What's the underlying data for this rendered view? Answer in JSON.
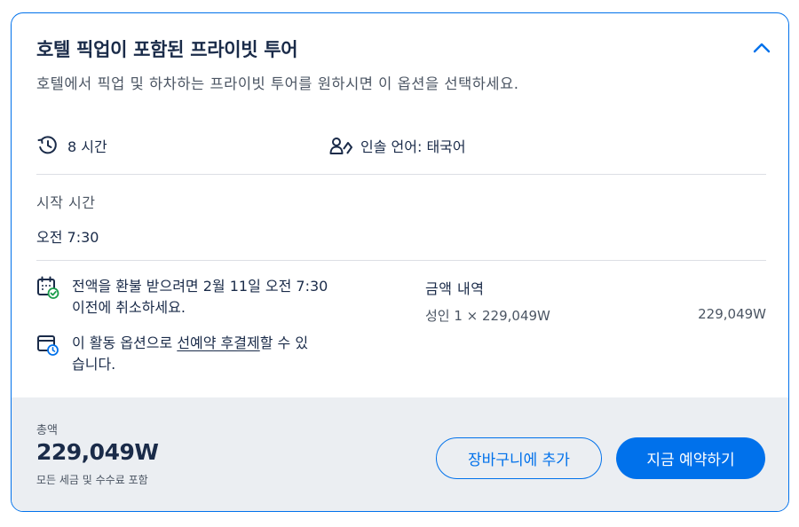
{
  "option": {
    "title": "호텔 픽업이 포함된 프라이빗 투어",
    "description": "호텔에서 픽업 및 하차하는 프라이빗 투어를 원하시면 이 옵션을 선택하세요.",
    "features": {
      "duration": {
        "icon": "clock-icon",
        "text": "8 시간"
      },
      "language": {
        "icon": "guide-language-icon",
        "text": "인솔 언어: 태국어"
      }
    },
    "start": {
      "label": "시작 시간",
      "time": "오전 7:30"
    },
    "cancellation": {
      "icon": "calendar-check-icon",
      "line1": "전액을 환불 받으려면 2월 11일 오전 7:30",
      "line2": "이전에 취소하세요."
    },
    "reserve": {
      "icon": "calendar-clock-icon",
      "before": "이 활동 옵션으로 ",
      "link": "선예약 후결제",
      "after": "할 수 있",
      "line2": "습니다."
    },
    "price": {
      "heading": "금액 내역",
      "row_label": "성인 1 × 229,049W",
      "row_value": "229,049W"
    }
  },
  "footer": {
    "total_label": "총액",
    "total_value": "229,049W",
    "total_note": "모든 세금 및 수수료 포함",
    "cart_button": "장바구니에 추가",
    "book_button": "지금 예약하기"
  },
  "colors": {
    "accent": "#0071eb",
    "text": "#1a2b49",
    "muted": "#4b5563",
    "footer_bg": "#ebeef2",
    "success": "#1a9c4a"
  }
}
